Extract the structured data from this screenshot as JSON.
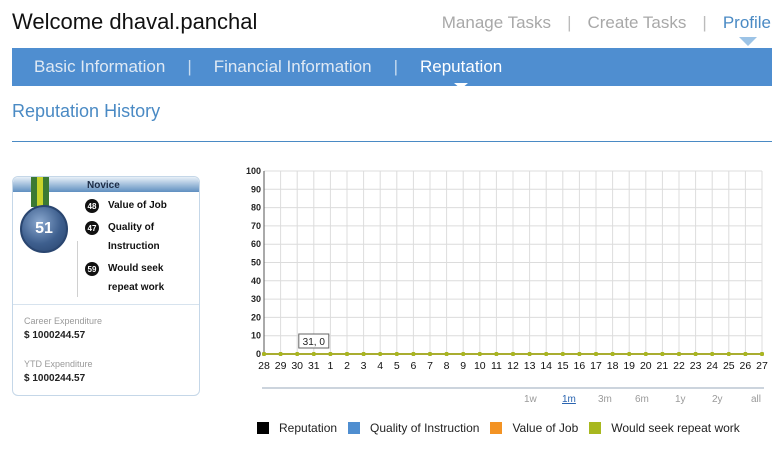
{
  "header": {
    "welcome": "Welcome dhaval.panchal",
    "nav": [
      {
        "label": "Manage Tasks",
        "active": false
      },
      {
        "label": "Create Tasks",
        "active": false
      },
      {
        "label": "Profile",
        "active": true
      }
    ],
    "nav_separator": "|"
  },
  "tabs": [
    {
      "label": "Basic Information",
      "active": false
    },
    {
      "label": "Financial Information",
      "active": false
    },
    {
      "label": "Reputation",
      "active": true
    }
  ],
  "section_title": "Reputation History",
  "card": {
    "rank": "Novice",
    "medal_score": "51",
    "scores": [
      {
        "value": "48",
        "label": "Value of Job"
      },
      {
        "value": "47",
        "label": "Quality of Instruction"
      },
      {
        "value": "59",
        "label": "Would seek repeat work"
      }
    ],
    "career_label": "Career Expenditure",
    "career_value": "$ 1000244.57",
    "ytd_label": "YTD Expenditure",
    "ytd_value": "$ 1000244.57"
  },
  "range_options": [
    {
      "label": "1w",
      "active": false
    },
    {
      "label": "1m",
      "active": true
    },
    {
      "label": "3m",
      "active": false
    },
    {
      "label": "6m",
      "active": false
    },
    {
      "label": "1y",
      "active": false
    },
    {
      "label": "2y",
      "active": false
    },
    {
      "label": "all",
      "active": false
    }
  ],
  "colors": {
    "accent": "#4f8ed0",
    "reputation": "#000000",
    "quality": "#4f8ed0",
    "value": "#f39324",
    "repeat": "#a8b81f"
  },
  "chart_data": {
    "type": "line",
    "x": [
      "28",
      "29",
      "30",
      "31",
      "1",
      "2",
      "3",
      "4",
      "5",
      "6",
      "7",
      "8",
      "9",
      "10",
      "11",
      "12",
      "13",
      "14",
      "15",
      "16",
      "17",
      "18",
      "19",
      "20",
      "21",
      "22",
      "23",
      "24",
      "25",
      "26",
      "27"
    ],
    "ylim": [
      0,
      100
    ],
    "y_ticks": [
      "0",
      "10",
      "20",
      "30",
      "40",
      "50",
      "60",
      "70",
      "80",
      "90",
      "100"
    ],
    "grid": true,
    "tooltip": "31, 0",
    "legend_placement": "bottom",
    "series": [
      {
        "name": "Reputation",
        "values": [
          0,
          0,
          0,
          0,
          0,
          0,
          0,
          0,
          0,
          0,
          0,
          0,
          0,
          0,
          0,
          0,
          0,
          0,
          0,
          0,
          0,
          0,
          0,
          0,
          0,
          0,
          0,
          0,
          0,
          0,
          0
        ]
      },
      {
        "name": "Quality of Instruction",
        "values": [
          0,
          0,
          0,
          0,
          0,
          0,
          0,
          0,
          0,
          0,
          0,
          0,
          0,
          0,
          0,
          0,
          0,
          0,
          0,
          0,
          0,
          0,
          0,
          0,
          0,
          0,
          0,
          0,
          0,
          0,
          0
        ]
      },
      {
        "name": "Value of Job",
        "values": [
          0,
          0,
          0,
          0,
          0,
          0,
          0,
          0,
          0,
          0,
          0,
          0,
          0,
          0,
          0,
          0,
          0,
          0,
          0,
          0,
          0,
          0,
          0,
          0,
          0,
          0,
          0,
          0,
          0,
          0,
          0
        ]
      },
      {
        "name": "Would seek repeat work",
        "values": [
          0,
          0,
          0,
          0,
          0,
          0,
          0,
          0,
          0,
          0,
          0,
          0,
          0,
          0,
          0,
          0,
          0,
          0,
          0,
          0,
          0,
          0,
          0,
          0,
          0,
          0,
          0,
          0,
          0,
          0,
          0
        ]
      }
    ]
  }
}
